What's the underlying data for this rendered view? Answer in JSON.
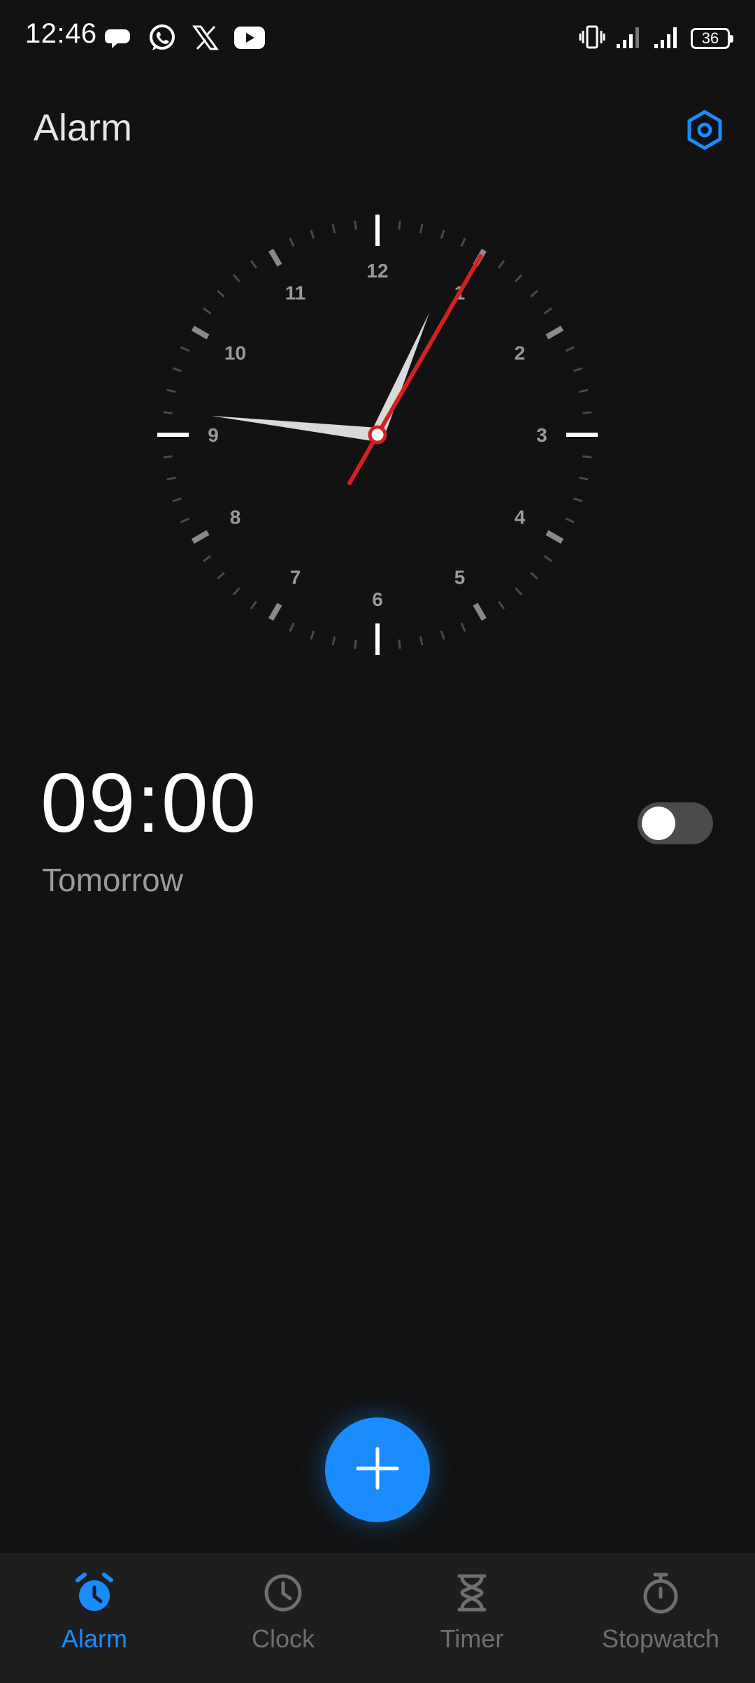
{
  "status_bar": {
    "time": "12:46",
    "notification_icons": [
      "chat-bubble-icon",
      "whatsapp-icon",
      "x-icon",
      "youtube-icon"
    ],
    "battery_level": "36",
    "system_icons": [
      "vibrate-icon",
      "signal-icon",
      "signal-icon"
    ]
  },
  "header": {
    "title": "Alarm",
    "settings_icon": "settings-icon"
  },
  "clock": {
    "numbers": [
      "12",
      "1",
      "2",
      "3",
      "4",
      "5",
      "6",
      "7",
      "8",
      "9",
      "10",
      "11"
    ],
    "hour": 12,
    "minute": 46,
    "second": 5,
    "second_hand_color": "#d42020"
  },
  "alarm": {
    "time": "09:00",
    "subtitle": "Tomorrow",
    "enabled": false
  },
  "fab": {
    "icon": "plus-icon",
    "color": "#1a8cff"
  },
  "bottom_nav": {
    "active": "Alarm",
    "items": [
      {
        "label": "Alarm",
        "icon": "alarm-clock-icon"
      },
      {
        "label": "Clock",
        "icon": "clock-icon"
      },
      {
        "label": "Timer",
        "icon": "hourglass-icon"
      },
      {
        "label": "Stopwatch",
        "icon": "stopwatch-icon"
      }
    ]
  },
  "colors": {
    "accent": "#1a8cff",
    "background": "#121212",
    "nav_background": "#1e1e1e"
  }
}
